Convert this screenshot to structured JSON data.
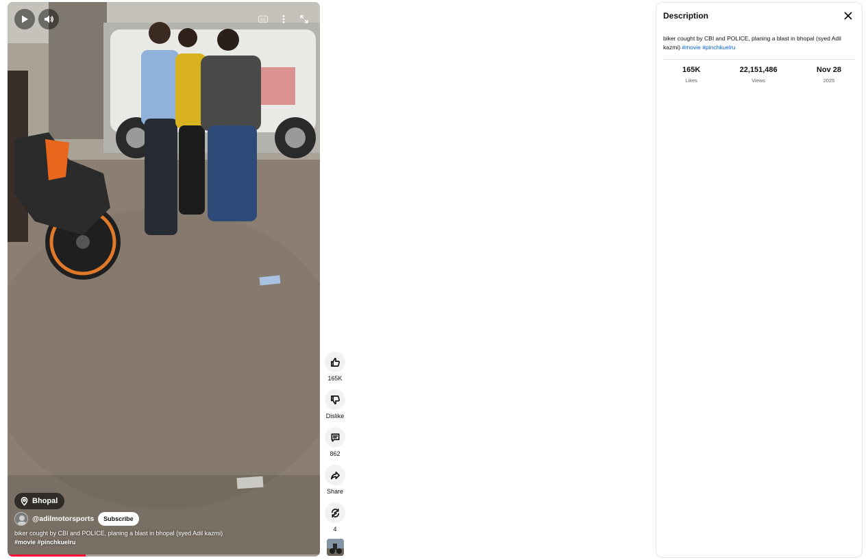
{
  "video": {
    "location": "Bhopal",
    "channel_handle": "@adilmotorsports",
    "subscribe_label": "Subscribe",
    "caption_line1": "biker cought by CBI and POLICE, planing a blast in bhopal (syed Adil kazmi)",
    "caption_tags": "#movie  #pinchkuelru",
    "progress_fraction": 0.25,
    "icons": {
      "play": "play-icon",
      "volume": "volume-icon",
      "captions": "captions-icon",
      "more": "more-vert-icon",
      "fullscreen": "fullscreen-icon",
      "location": "location-pin-icon"
    }
  },
  "actions": {
    "like_count": "165K",
    "dislike_label": "Dislike",
    "comment_count": "862",
    "share_label": "Share",
    "remix_count": "4"
  },
  "description_panel": {
    "title": "Description",
    "text": "biker cought by CBI and POLICE, planing a blast in bhopal (syed Adil kazmi)",
    "tags": [
      "#movie",
      "#pinchkuelru"
    ],
    "stats": [
      {
        "value": "165K",
        "label": "Likes"
      },
      {
        "value": "22,151,486",
        "label": "Views"
      },
      {
        "value": "Nov 28",
        "label": "2025"
      }
    ]
  },
  "colors": {
    "accent": "#ff0033",
    "link": "#065fd4",
    "subtle_text": "#606060"
  }
}
